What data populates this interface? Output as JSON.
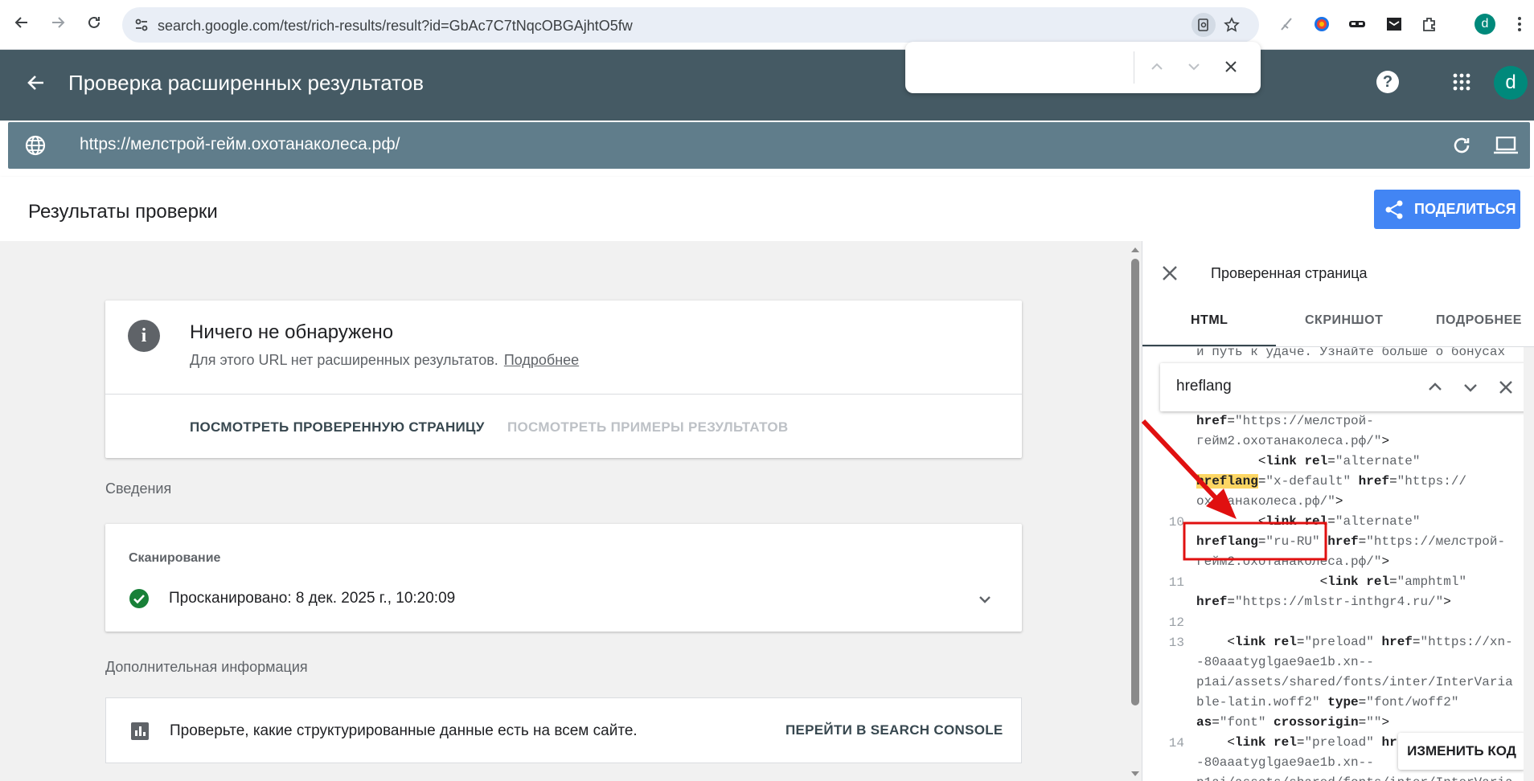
{
  "browser": {
    "url": "search.google.com/test/rich-results/result?id=GbAc7C7tNqcOBGAjhtO5fw",
    "profile_letter": "d"
  },
  "app": {
    "title": "Проверка расширенных результатов",
    "profile_letter": "d",
    "tested_url": "https://мелстрой-гейм.охотанаколеса.рф/"
  },
  "results": {
    "title": "Результаты проверки",
    "share_label": "ПОДЕЛИТЬСЯ"
  },
  "status_card": {
    "heading": "Ничего не обнаружено",
    "text": "Для этого URL нет расширенных результатов.",
    "more_link": "Подробнее",
    "view_page": "ПОСМОТРЕТЬ ПРОВЕРЕННУЮ СТРАНИЦУ",
    "view_examples": "ПОСМОТРЕТЬ ПРИМЕРЫ РЕЗУЛЬТАТОВ"
  },
  "details": {
    "section": "Сведения",
    "scan_title": "Сканирование",
    "scan_text": "Просканировано: 8 дек. 2025 г., 10:20:09"
  },
  "extra": {
    "section": "Дополнительная информация",
    "text": "Проверьте, какие структурированные данные есть на всем сайте.",
    "link": "ПЕРЕЙТИ В SEARCH CONSOLE"
  },
  "panel": {
    "title": "Проверенная страница",
    "tabs": [
      "HTML",
      "СКРИНШОТ",
      "ПОДРОБНЕЕ"
    ],
    "search_value": "hreflang",
    "edit_button": "ИЗМЕНИТЬ КОД",
    "top_text": "и путь к удаче. Узнайте больше о бонусах",
    "line_numbers": [
      "10",
      "11",
      "12",
      "13",
      "14"
    ]
  },
  "colors": {
    "appbar": "#455a64",
    "urlbar": "#607d8b",
    "accent": "#4285f4",
    "highlight": "#fdd663",
    "annotation": "#e01010"
  }
}
